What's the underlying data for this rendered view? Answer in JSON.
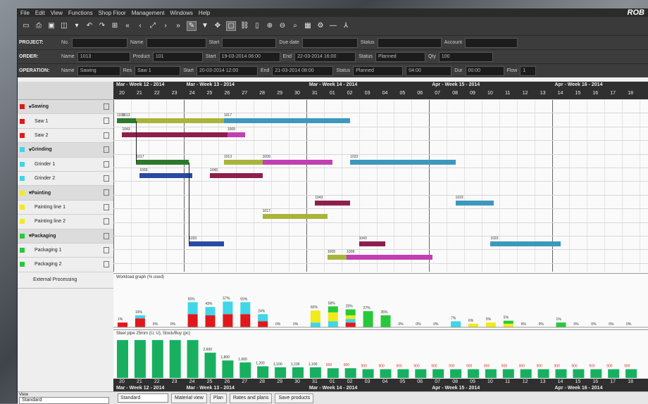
{
  "menu": [
    "File",
    "Edit",
    "View",
    "Functions",
    "Shop Floor",
    "Management",
    "Windows",
    "Help"
  ],
  "brand": "ROB",
  "toolbar_icons": [
    "new-icon",
    "print-icon",
    "save-icon",
    "preview-icon",
    "options-icon",
    "undo-icon",
    "redo-icon",
    "filter-icon",
    "first-icon",
    "prev-icon",
    "expand-icon",
    "next-icon",
    "last-icon",
    "pen-icon",
    "funnel-icon",
    "move-icon",
    "select-icon",
    "link-icon",
    "page-icon",
    "zoom-in-icon",
    "zoom-out-icon",
    "search-icon",
    "grid-icon",
    "settings-icon",
    "minus-icon",
    "tree-icon"
  ],
  "filters": {
    "project": {
      "label": "PROJECT:",
      "no_label": "No.",
      "name_label": "Name",
      "start_label": "Start",
      "due_label": "Due date",
      "status_label": "Status",
      "account_label": "Account"
    },
    "order": {
      "label": "ORDER:",
      "name_label": "Name",
      "name_value": "1013",
      "product_label": "Product",
      "product_value": "101",
      "start_label": "Start",
      "start_value": "19-03-2014 06:00",
      "end_label": "End",
      "end_value": "22-03-2014 16:00",
      "status_label": "Status",
      "status_value": "Planned",
      "qty_label": "Qty",
      "qty_value": "100"
    },
    "operation": {
      "label": "OPERATION:",
      "name_label": "Name",
      "name_value": "Sawing",
      "res_label": "Res",
      "res_value": "Saw 1",
      "start_label": "Start",
      "start_value": "20-03-2014 12:00",
      "end_label": "End",
      "end_value": "21-03-2014 08:00",
      "status_label": "Status",
      "status_value": "Planned",
      "dur_value": "04:00",
      "dur_label": "Dur",
      "dur2_value": "00:00",
      "flow_label": "Flow",
      "flow_value": "1"
    }
  },
  "resources": [
    {
      "label": "Sawing",
      "group": true,
      "color": "#e0181b"
    },
    {
      "label": "Saw 1",
      "group": false,
      "color": "#e0181b"
    },
    {
      "label": "Saw 2",
      "group": false,
      "color": "#e0181b"
    },
    {
      "label": "Grinding",
      "group": true,
      "color": "#3fd6e8"
    },
    {
      "label": "Grinder 1",
      "group": false,
      "color": "#3fd6e8"
    },
    {
      "label": "Grinder 2",
      "group": false,
      "color": "#3fd6e8"
    },
    {
      "label": "Painting",
      "group": true,
      "color": "#f2ea1a"
    },
    {
      "label": "Painting line 1",
      "group": false,
      "color": "#f2ea1a"
    },
    {
      "label": "Painting line 2",
      "group": false,
      "color": "#f2ea1a"
    },
    {
      "label": "Packaging",
      "group": true,
      "color": "#27c93a"
    },
    {
      "label": "Packaging 1",
      "group": false,
      "color": "#27c93a"
    },
    {
      "label": "Packaging 2",
      "group": false,
      "color": "#27c93a"
    }
  ],
  "external_label": "External Processing",
  "timeline_weeks": [
    {
      "label": "Mar - Week 12 - 2014",
      "day_index": 0
    },
    {
      "label": "Mar - Week 13 - 2014",
      "day_index": 4
    },
    {
      "label": "Mar - Week 14 - 2014",
      "day_index": 11
    },
    {
      "label": "Apr - Week 15 - 2014",
      "day_index": 18
    },
    {
      "label": "Apr - Week 16 - 2014",
      "day_index": 25
    }
  ],
  "timeline_days": [
    "20",
    "21",
    "22",
    "23",
    "24",
    "25",
    "26",
    "27",
    "28",
    "29",
    "30",
    "31",
    "01",
    "02",
    "03",
    "04",
    "05",
    "06",
    "07",
    "08",
    "09",
    "10",
    "11",
    "12",
    "13",
    "14",
    "15",
    "16",
    "17",
    "18"
  ],
  "gantt_bars": [
    {
      "row": 1,
      "start_day": 0.5,
      "end_day": 6.3,
      "color": "#a8b43a",
      "label": "1013"
    },
    {
      "row": 1,
      "start_day": 6.3,
      "end_day": 13.5,
      "color": "#3d98be",
      "label": "1017"
    },
    {
      "row": 1,
      "start_day": 0.2,
      "end_day": 1.3,
      "color": "#2b7a2b",
      "label": "1033"
    },
    {
      "row": 2,
      "start_day": 0.5,
      "end_day": 6.5,
      "color": "#8d1f4d",
      "label": "1043"
    },
    {
      "row": 2,
      "start_day": 6.5,
      "end_day": 7.5,
      "color": "#c23fb2",
      "label": "1009"
    },
    {
      "row": 4,
      "start_day": 1.3,
      "end_day": 4.3,
      "color": "#2b7a2b",
      "label": "1017"
    },
    {
      "row": 4,
      "start_day": 6.3,
      "end_day": 8.5,
      "color": "#a8b43a",
      "label": "1013"
    },
    {
      "row": 4,
      "start_day": 8.5,
      "end_day": 12.5,
      "color": "#c23fb2",
      "label": "1009"
    },
    {
      "row": 4,
      "start_day": 13.5,
      "end_day": 19.5,
      "color": "#3d98be",
      "label": "1023"
    },
    {
      "row": 5,
      "start_day": 1.5,
      "end_day": 4.5,
      "color": "#2a4aa0",
      "label": "1033"
    },
    {
      "row": 5,
      "start_day": 5.5,
      "end_day": 8.5,
      "color": "#8d1f4d",
      "label": "1043"
    },
    {
      "row": 7,
      "start_day": 11.5,
      "end_day": 13.5,
      "color": "#8d1f4d",
      "label": "1043"
    },
    {
      "row": 7,
      "start_day": 19.5,
      "end_day": 21.7,
      "color": "#3d98be",
      "label": "1023"
    },
    {
      "row": 8,
      "start_day": 8.5,
      "end_day": 12.2,
      "color": "#a8b43a",
      "label": "1017"
    },
    {
      "row": 10,
      "start_day": 4.3,
      "end_day": 6.3,
      "color": "#2a4aa0",
      "label": "1033"
    },
    {
      "row": 10,
      "start_day": 14.0,
      "end_day": 15.5,
      "color": "#8d1f4d",
      "label": "1043"
    },
    {
      "row": 10,
      "start_day": 21.5,
      "end_day": 25.5,
      "color": "#3d98be",
      "label": "1023"
    },
    {
      "row": 11,
      "start_day": 12.2,
      "end_day": 13.3,
      "color": "#a8b43a",
      "label": "1009"
    },
    {
      "row": 11,
      "start_day": 13.3,
      "end_day": 18.2,
      "color": "#c23fb2",
      "label": "1009"
    }
  ],
  "chart_data": [
    {
      "type": "bar",
      "title": "Workload graph (% used)",
      "categories": [
        "20",
        "21",
        "22",
        "23",
        "24",
        "25",
        "26",
        "27",
        "28",
        "29",
        "30",
        "31",
        "01",
        "02",
        "03",
        "04",
        "05",
        "06",
        "07",
        "08",
        "09",
        "10",
        "11",
        "12",
        "13",
        "14",
        "15",
        "16",
        "17",
        "18"
      ],
      "series": [
        {
          "name": "Sawing",
          "color": "#e0181b",
          "values": [
            8,
            15,
            0,
            0,
            22,
            20,
            22,
            22,
            10,
            0,
            0,
            0,
            0,
            8,
            0,
            0,
            0,
            0,
            0,
            0,
            0,
            0,
            0,
            0,
            0,
            0,
            0,
            0,
            0,
            0
          ]
        },
        {
          "name": "Grinding",
          "color": "#3fd6e8",
          "values": [
            0,
            5,
            0,
            0,
            20,
            14,
            21,
            20,
            12,
            0,
            0,
            8,
            10,
            6,
            0,
            0,
            0,
            0,
            0,
            10,
            0,
            0,
            0,
            0,
            0,
            0,
            0,
            0,
            0,
            0
          ]
        },
        {
          "name": "Painting",
          "color": "#f2ea1a",
          "values": [
            0,
            0,
            0,
            0,
            0,
            0,
            0,
            0,
            0,
            0,
            0,
            20,
            15,
            6,
            0,
            0,
            0,
            0,
            0,
            0,
            6,
            8,
            6,
            0,
            0,
            0,
            0,
            0,
            0,
            0
          ]
        },
        {
          "name": "Packaging",
          "color": "#27c93a",
          "values": [
            0,
            0,
            0,
            0,
            0,
            0,
            0,
            0,
            0,
            0,
            0,
            0,
            10,
            10,
            27,
            20,
            0,
            0,
            0,
            0,
            0,
            0,
            5,
            0,
            0,
            8,
            0,
            0,
            0,
            0
          ]
        }
      ],
      "data_labels": [
        "1%",
        "19%",
        "0%",
        "0%",
        "55%",
        "43%",
        "57%",
        "55%",
        "24%",
        "0%",
        "0%",
        "60%",
        "58%",
        "25%",
        "27%",
        "35%",
        "0%",
        "0%",
        "0%",
        "7%",
        "6%",
        "5%",
        "5%",
        "6%",
        "0%",
        "1%",
        "0%",
        "0%",
        "0%",
        "0%"
      ],
      "ylim": [
        0,
        70
      ]
    },
    {
      "type": "bar",
      "title": "Steel pipe 25mm (U, U), Stock/Buy (pc)",
      "categories": [
        "20",
        "21",
        "22",
        "23",
        "24",
        "25",
        "26",
        "27",
        "28",
        "29",
        "30",
        "31",
        "01",
        "02",
        "03",
        "04",
        "05",
        "06",
        "07",
        "08",
        "09",
        "10",
        "11",
        "12",
        "13",
        "14",
        "15",
        "16",
        "17",
        "18"
      ],
      "values": [
        3900,
        3900,
        3900,
        3900,
        3900,
        2600,
        1800,
        1600,
        1200,
        1100,
        1100,
        1100,
        1000,
        1000,
        900,
        900,
        900,
        900,
        900,
        900,
        900,
        900,
        900,
        900,
        900,
        900,
        900,
        900,
        900,
        900
      ],
      "color": "#18b060",
      "data_labels": [
        "",
        "",
        "",
        "",
        "",
        "2,600",
        "1,800",
        "1,600",
        "1,200",
        "1,100",
        "1,100",
        "1,100",
        "900",
        "900",
        "900",
        "900",
        "900",
        "900",
        "900",
        "900",
        "900",
        "900",
        "900",
        "900",
        "900",
        "900",
        "900",
        "900",
        "900",
        "900"
      ],
      "ylim": [
        0,
        4200
      ]
    }
  ],
  "status": {
    "view_label": "View",
    "view_value": "Standard",
    "view2_value": "Standard",
    "tabs": [
      "Material view",
      "Plan",
      "Rates and plans",
      "Save products"
    ]
  }
}
